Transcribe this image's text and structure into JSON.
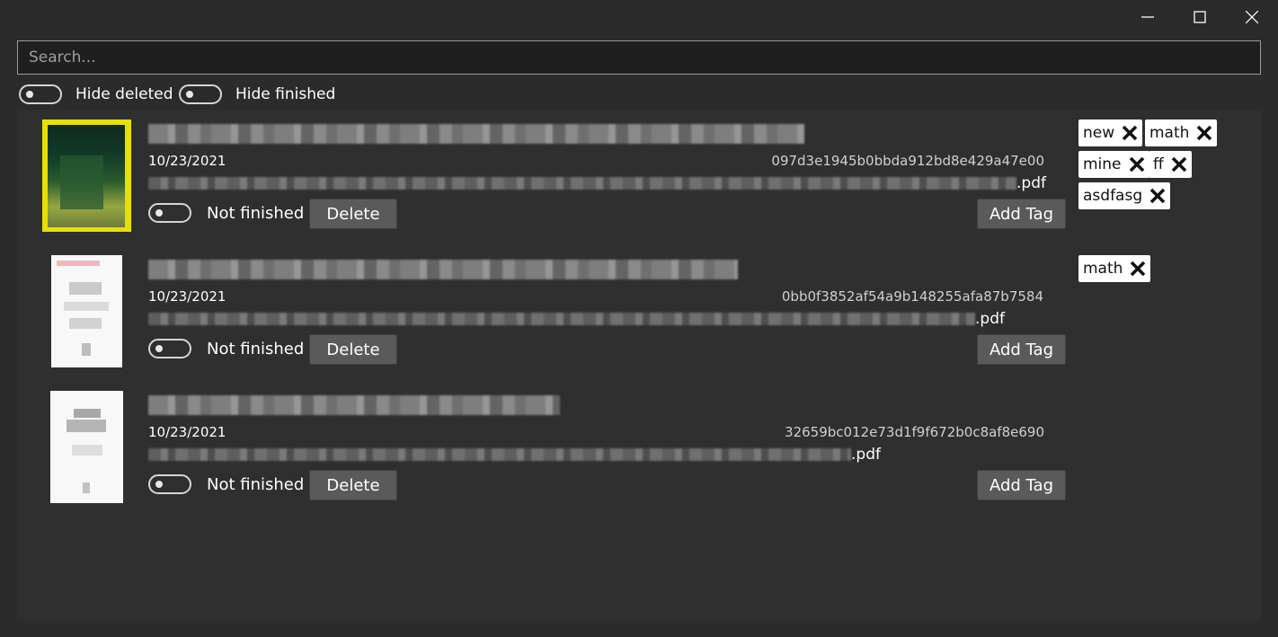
{
  "search": {
    "placeholder": "Search..."
  },
  "filters": {
    "hide_deleted": "Hide deleted",
    "hide_finished": "Hide finished"
  },
  "documents": [
    {
      "date": "10/23/2021",
      "hash": "097d3e1945b0bbda912bd8e429a47e00",
      "ext": ".pdf",
      "status": "Not finished",
      "delete_label": "Delete",
      "add_tag_label": "Add Tag",
      "tags": [
        "new",
        "math",
        "mine",
        "ff",
        "asdfasg"
      ]
    },
    {
      "date": "10/23/2021",
      "hash": "0bb0f3852af54a9b148255afa87b7584",
      "ext": ".pdf",
      "status": "Not finished",
      "delete_label": "Delete",
      "add_tag_label": "Add Tag",
      "tags": [
        "math"
      ]
    },
    {
      "date": "10/23/2021",
      "hash": "32659bc012e73d1f9f672b0c8af8e690",
      "ext": ".pdf",
      "status": "Not finished",
      "delete_label": "Delete",
      "add_tag_label": "Add Tag",
      "tags": []
    }
  ]
}
